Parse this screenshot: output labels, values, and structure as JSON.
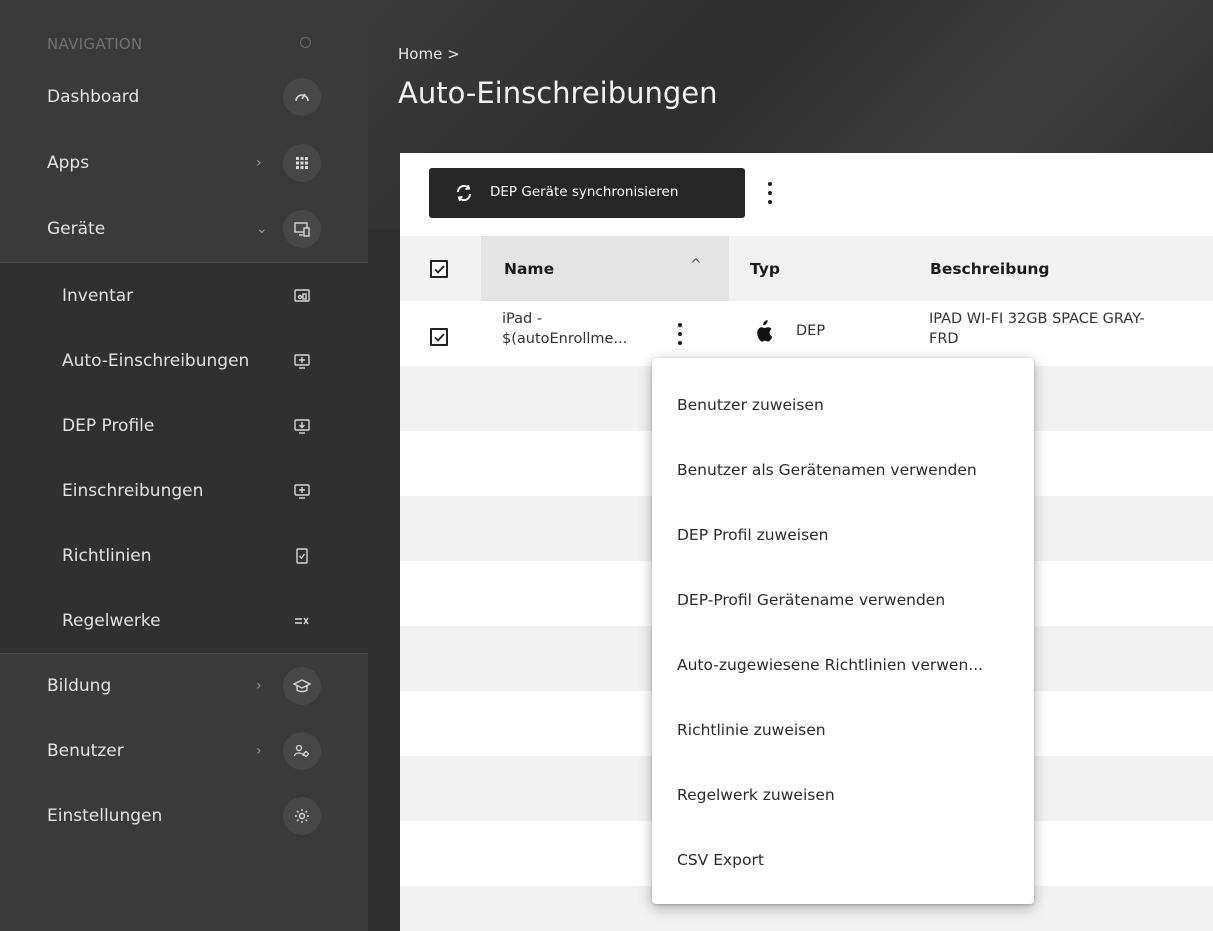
{
  "sidebar": {
    "heading": "NAVIGATION",
    "items": [
      {
        "label": "Dashboard",
        "icon": "dashboard-icon"
      },
      {
        "label": "Apps",
        "icon": "grid-icon",
        "chevron": "›"
      },
      {
        "label": "Geräte",
        "icon": "devices-icon",
        "chevron": "⌄"
      },
      {
        "label": "Inventar",
        "icon": "inventory-icon"
      },
      {
        "label": "Auto-Einschreibungen",
        "icon": "auto-enroll-icon"
      },
      {
        "label": "DEP Profile",
        "icon": "dep-profile-icon"
      },
      {
        "label": "Einschreibungen",
        "icon": "enroll-icon"
      },
      {
        "label": "Richtlinien",
        "icon": "policy-icon"
      },
      {
        "label": "Regelwerke",
        "icon": "ruleset-icon"
      },
      {
        "label": "Bildung",
        "icon": "education-icon",
        "chevron": "›"
      },
      {
        "label": "Benutzer",
        "icon": "users-icon",
        "chevron": "›"
      },
      {
        "label": "Einstellungen",
        "icon": "gear-icon"
      }
    ]
  },
  "header": {
    "breadcrumb": "Home >",
    "title": "Auto-Einschreibungen"
  },
  "toolbar": {
    "sync_label": "DEP Geräte synchronisieren"
  },
  "table": {
    "columns": [
      "Name",
      "Typ",
      "Beschreibung"
    ],
    "sort_indicator": "^",
    "rows": [
      {
        "name_line1": "iPad -",
        "name_line2": "$(autoEnrollme...",
        "type": "DEP",
        "desc_line1": "IPAD WI-FI 32GB SPACE GRAY-",
        "desc_line2": "FRD",
        "checked": true
      }
    ]
  },
  "menu": {
    "items": [
      "Benutzer zuweisen",
      "Benutzer als Gerätenamen verwenden",
      "DEP Profil zuweisen",
      "DEP-Profil Gerätename verwenden",
      "Auto-zugewiesene Richtlinien verwen...",
      "Richtlinie zuweisen",
      "Regelwerk zuweisen",
      "CSV Export"
    ]
  }
}
